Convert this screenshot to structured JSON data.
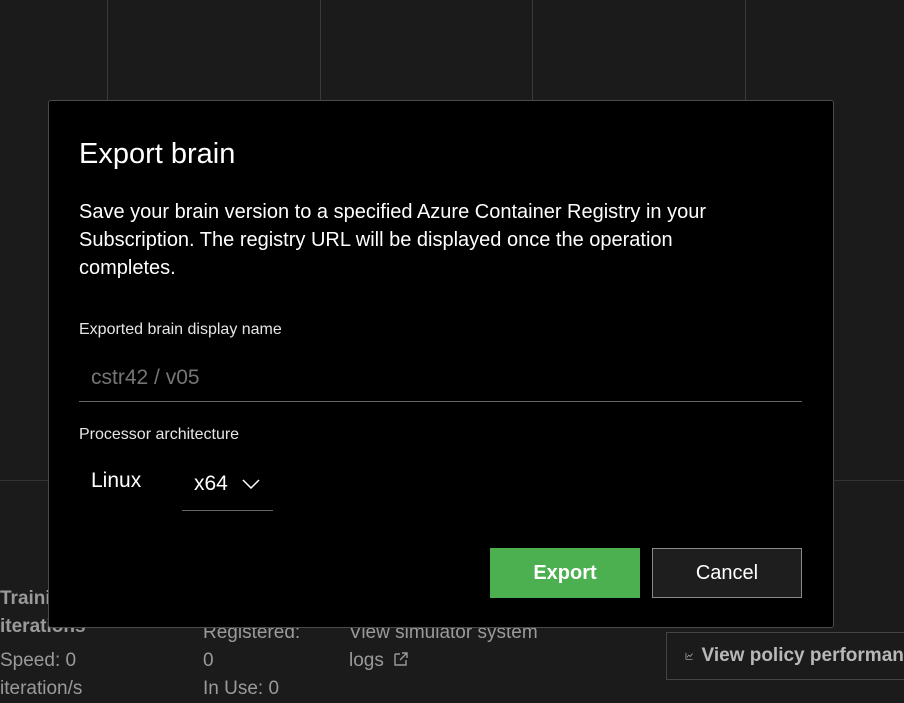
{
  "background": {
    "stats": {
      "training_label_line1": "Training",
      "training_label_line2": "iterations",
      "speed_line1": "Speed: 0",
      "speed_line2": "iteration/s",
      "registered_line1": "Registered:",
      "registered_line2": "0",
      "in_use": "In Use: 0",
      "sim_logs_line1": "View simulator system",
      "sim_logs_line2": "logs",
      "policy_button": "View policy performance"
    }
  },
  "dialog": {
    "title": "Export brain",
    "description": "Save your brain version to a specified Azure Container Registry in your Subscription. The registry URL will be displayed once the operation completes.",
    "name_label": "Exported brain display name",
    "name_placeholder": "cstr42 / v05",
    "arch_label": "Processor architecture",
    "os": "Linux",
    "arch_value": "x64",
    "export_label": "Export",
    "cancel_label": "Cancel"
  }
}
